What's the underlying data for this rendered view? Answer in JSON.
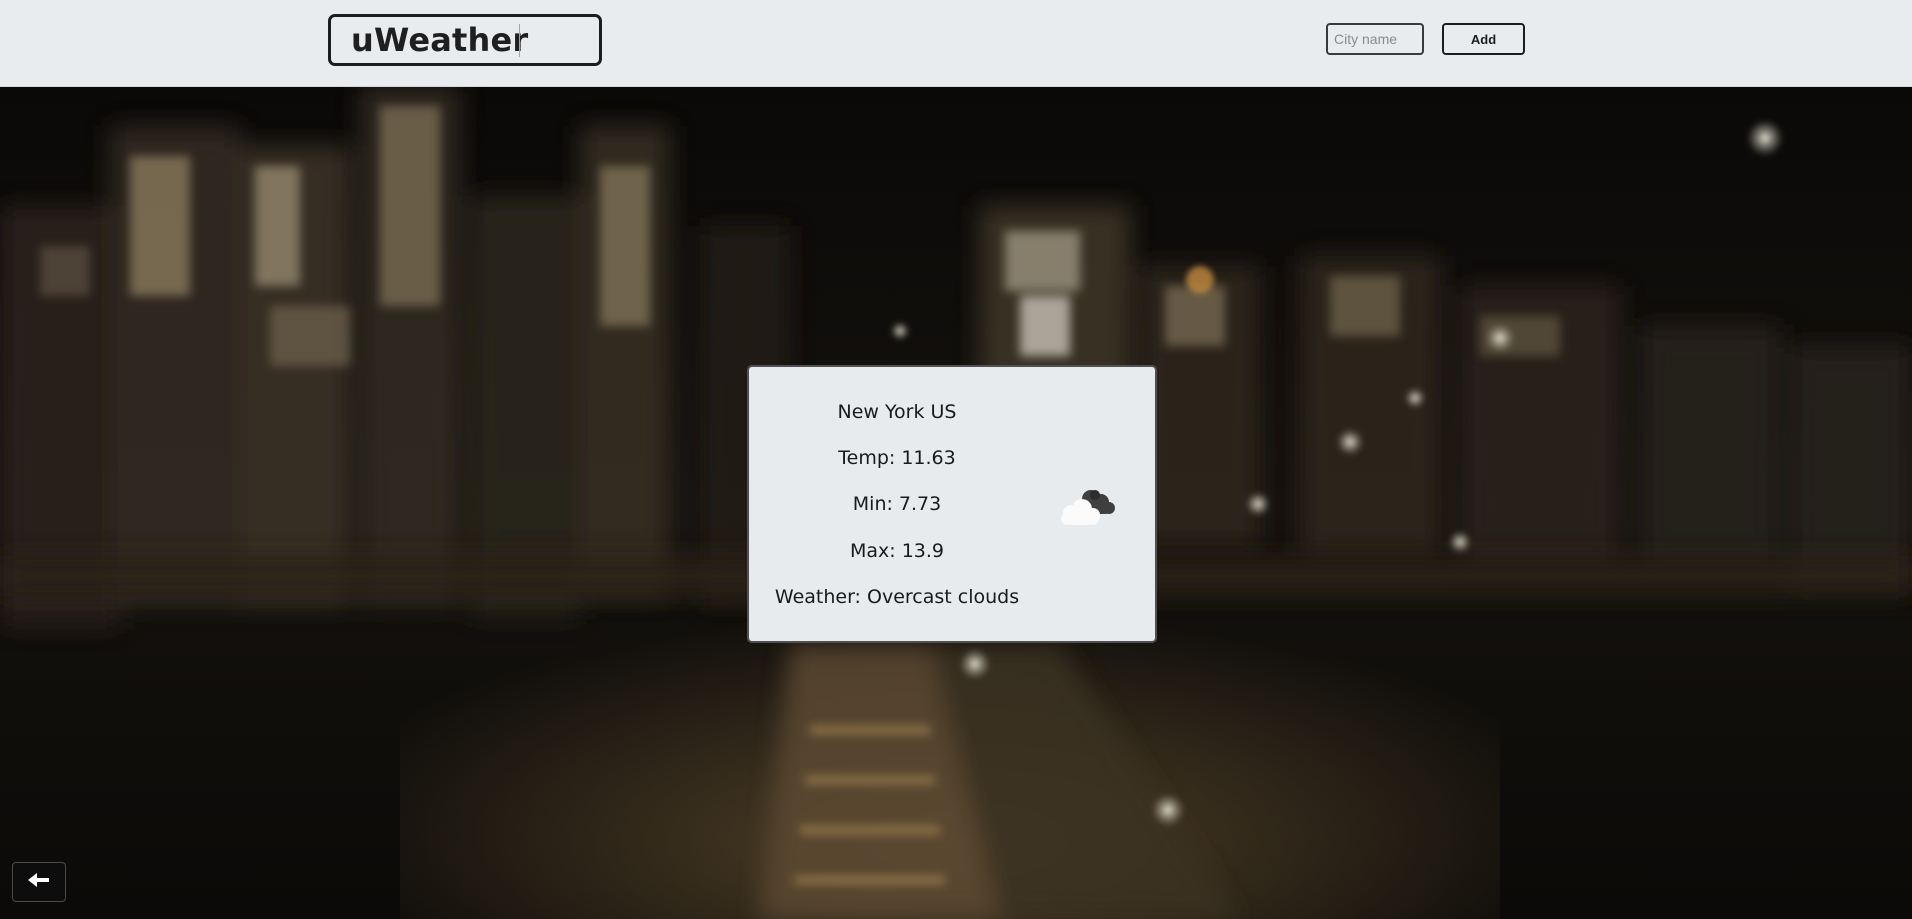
{
  "app": {
    "title": "uWeather"
  },
  "search": {
    "placeholder": "City name",
    "value": ""
  },
  "toolbar": {
    "add_label": "Add"
  },
  "weather": {
    "city_line": "New York US",
    "temp_line": "Temp: 11.63",
    "min_line": "Min: 7.73",
    "max_line": "Max: 13.9",
    "desc_line": "Weather: Overcast clouds",
    "icon": "overcast-clouds-icon"
  },
  "navigation": {
    "back_icon": "arrow-left-icon"
  },
  "colors": {
    "header_bg": "#e9ecef",
    "card_bg": "#e8ebee",
    "text": "#1a1a1a",
    "border": "#1d1d1d"
  }
}
